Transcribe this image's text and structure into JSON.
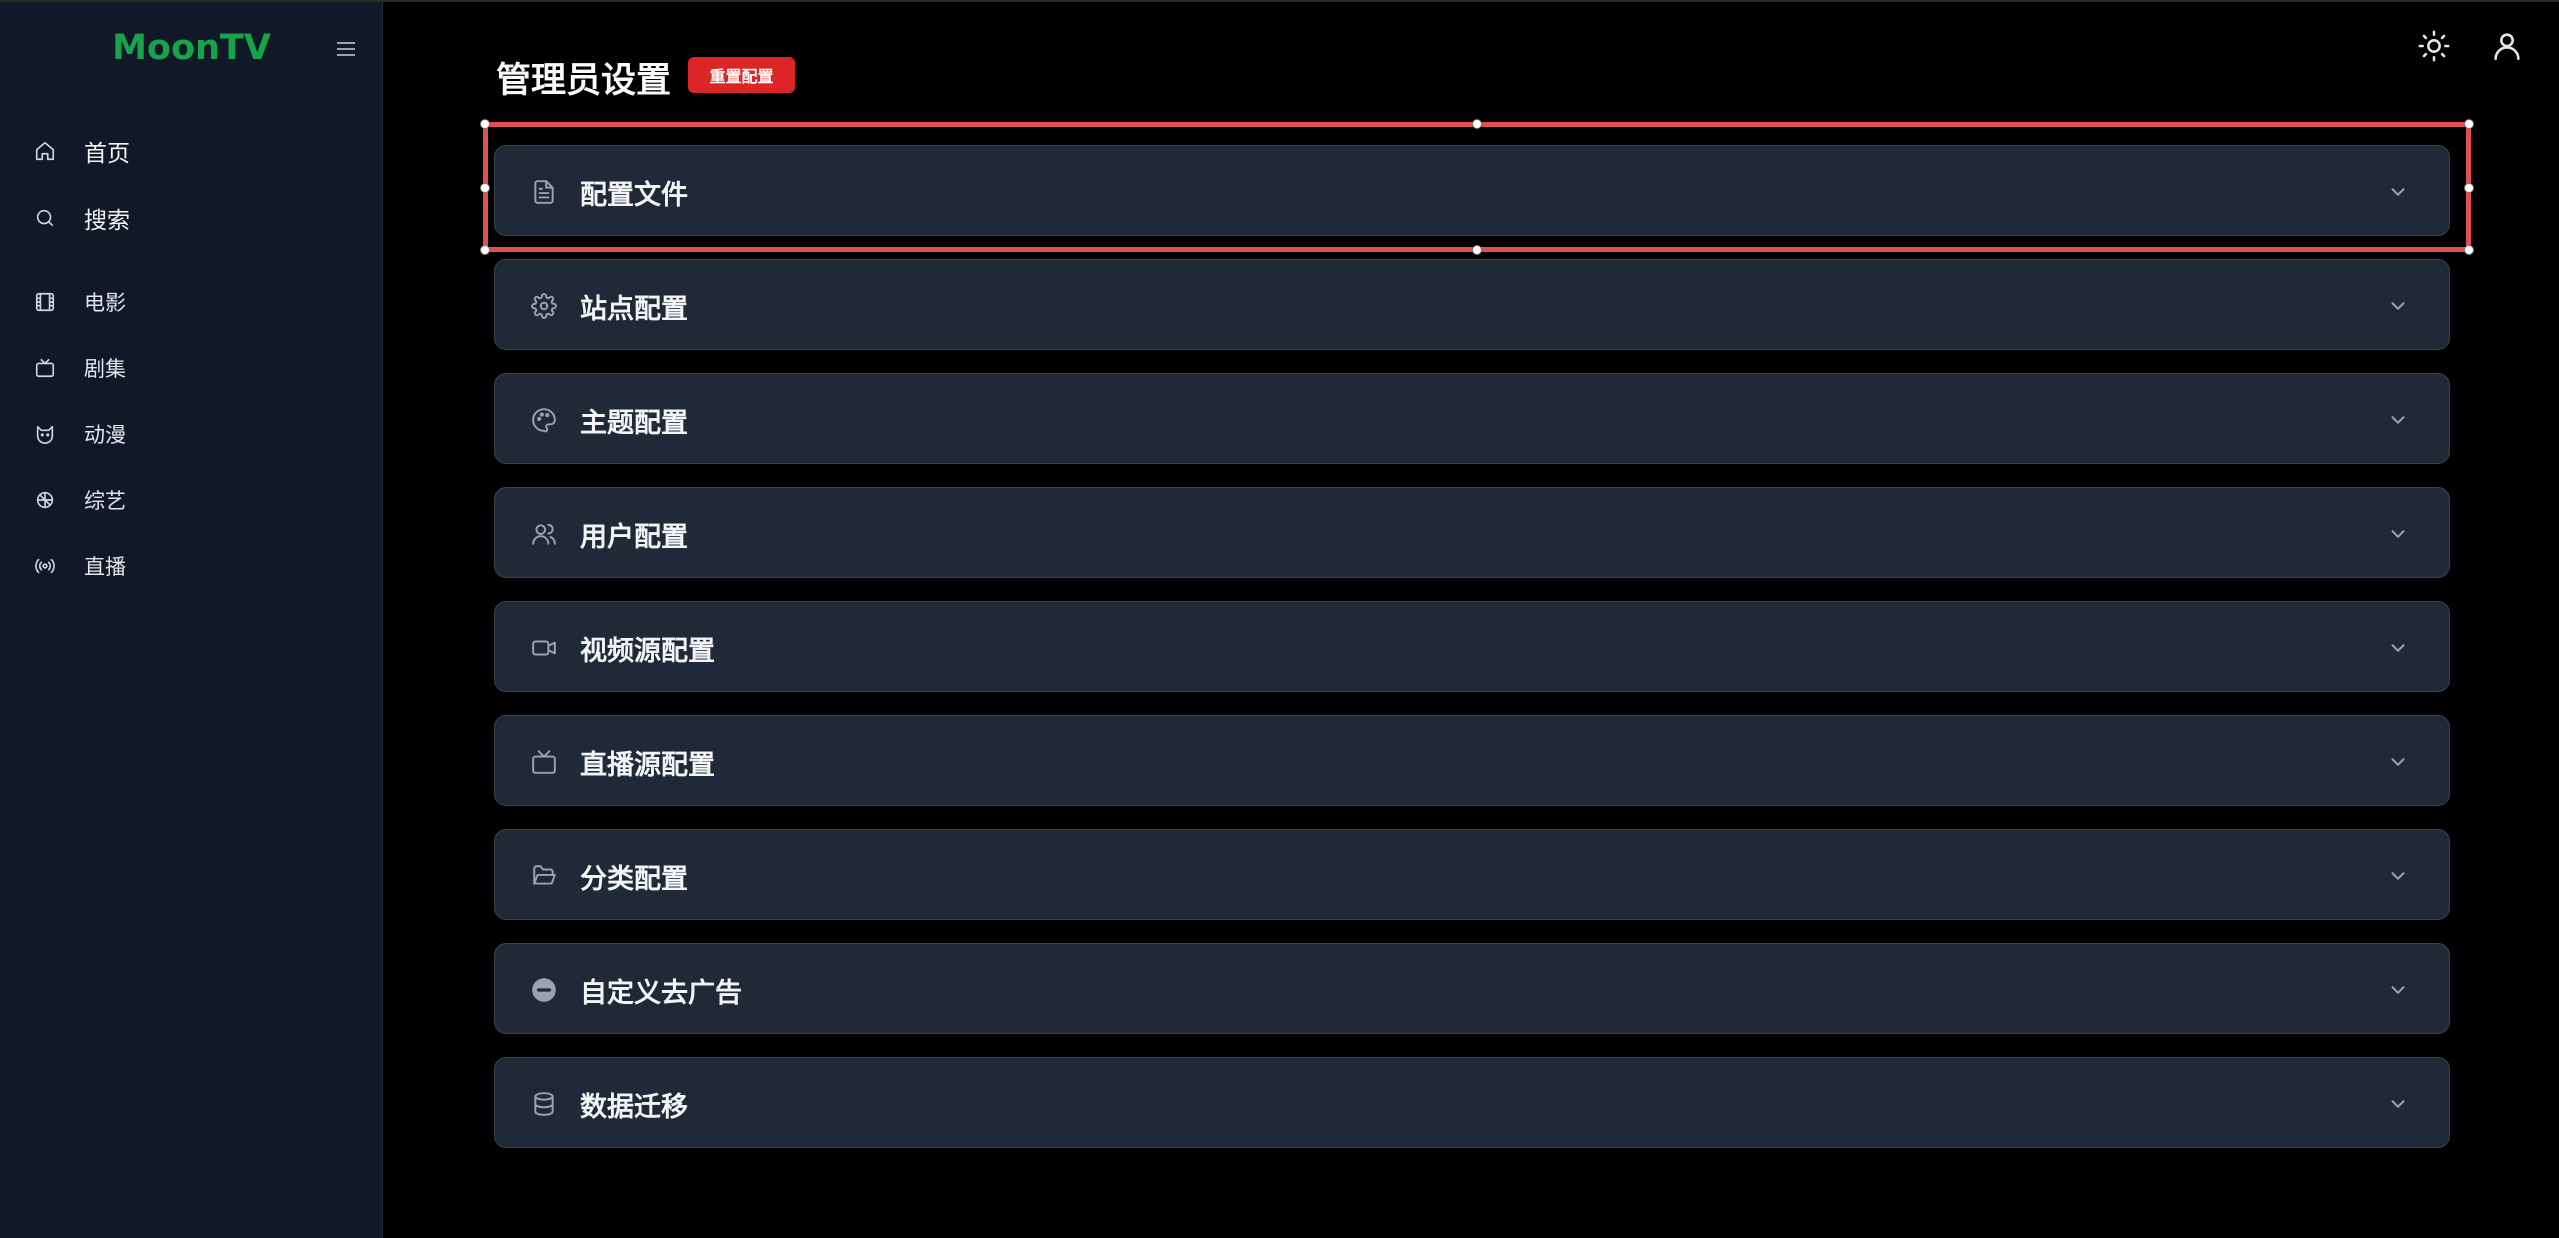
{
  "sidebar": {
    "brand": "MoonTV",
    "menu_icon": "hamburger-menu-icon",
    "items": [
      {
        "label": "首页",
        "icon": "home-icon"
      },
      {
        "label": "搜索",
        "icon": "search-icon"
      },
      {
        "label": "电影",
        "icon": "film-icon"
      },
      {
        "label": "剧集",
        "icon": "tv-icon"
      },
      {
        "label": "动漫",
        "icon": "cat-icon"
      },
      {
        "label": "综艺",
        "icon": "clover-icon"
      },
      {
        "label": "直播",
        "icon": "radio-icon"
      }
    ]
  },
  "topbar": {
    "theme_icon": "sun-icon",
    "user_icon": "user-icon"
  },
  "header": {
    "title": "管理员设置",
    "reset_label": "重置配置"
  },
  "panels": [
    {
      "title": "配置文件",
      "icon": "file-text-icon",
      "selected": true
    },
    {
      "title": "站点配置",
      "icon": "settings-icon"
    },
    {
      "title": "主题配置",
      "icon": "palette-icon"
    },
    {
      "title": "用户配置",
      "icon": "users-icon"
    },
    {
      "title": "视频源配置",
      "icon": "video-icon"
    },
    {
      "title": "直播源配置",
      "icon": "tv-icon"
    },
    {
      "title": "分类配置",
      "icon": "folder-open-icon"
    },
    {
      "title": "自定义去广告",
      "icon": "minus-circle-icon"
    },
    {
      "title": "数据迁移",
      "icon": "database-icon"
    }
  ],
  "colors": {
    "brand": "#16a34a",
    "danger": "#dc2626",
    "selection": "#e05252",
    "panel_bg": "#1f2937",
    "sidebar_bg": "#111827"
  }
}
